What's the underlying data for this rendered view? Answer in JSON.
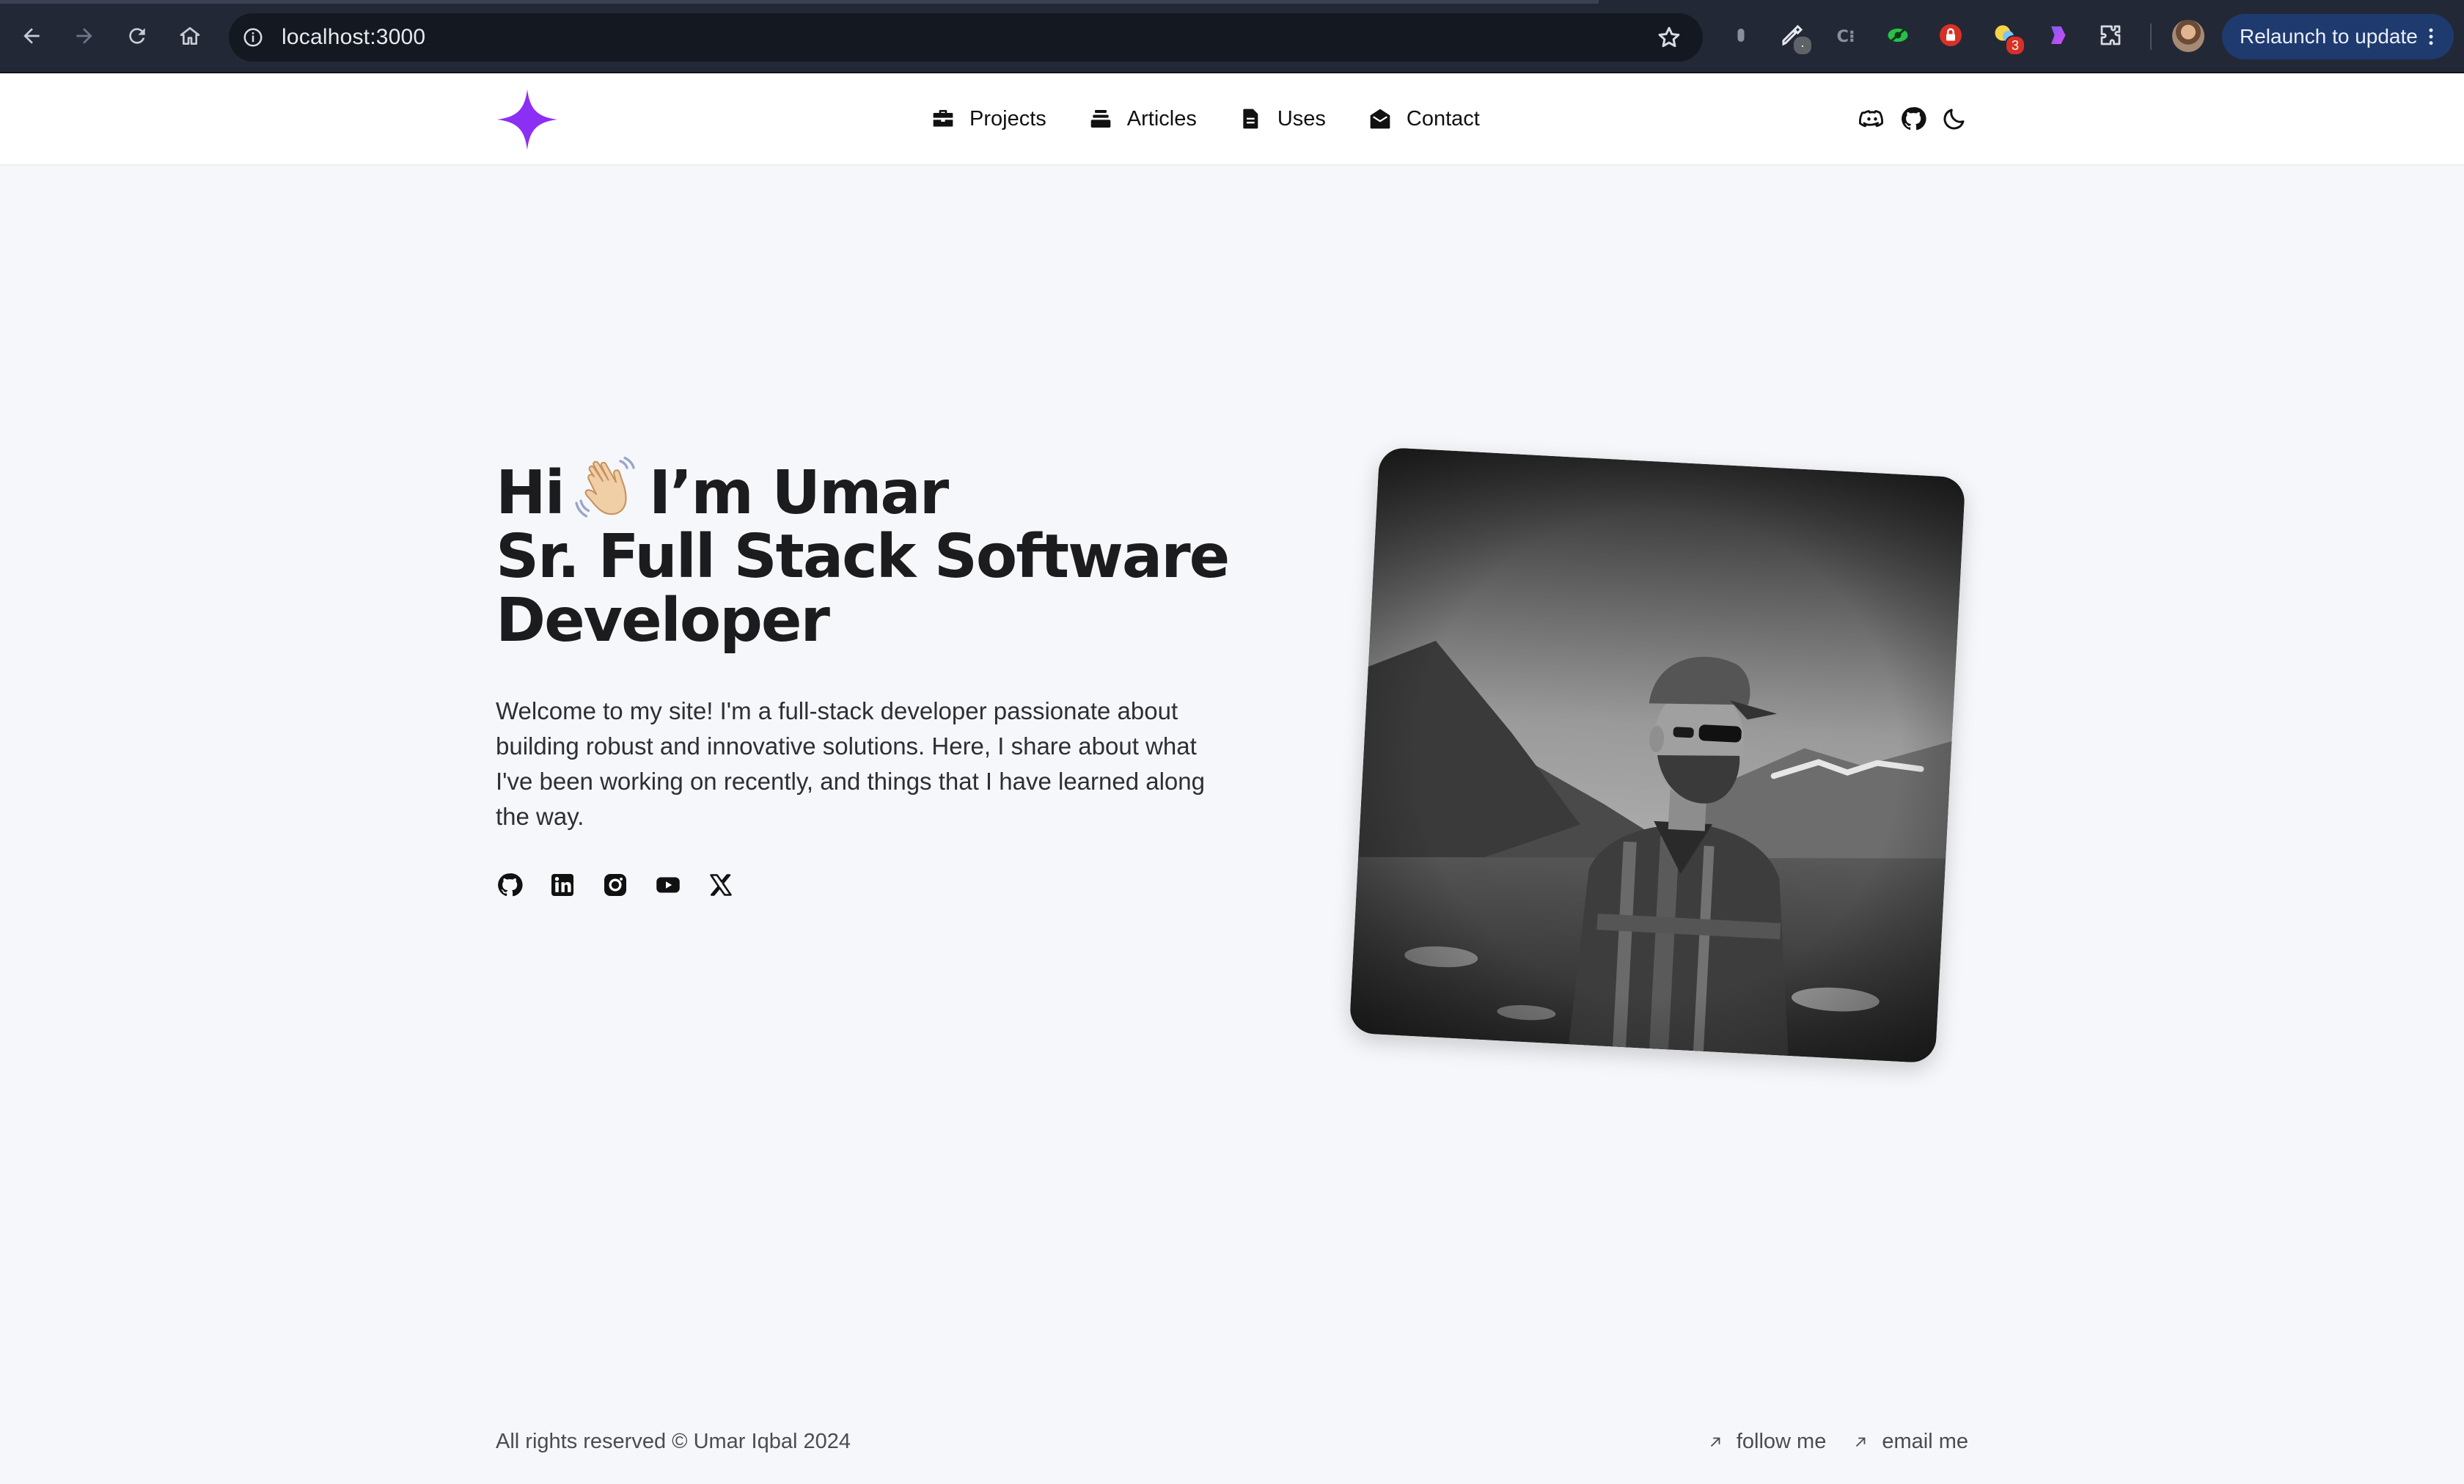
{
  "browser": {
    "url": "localhost:3000",
    "relaunch_label": "Relaunch to update",
    "extension_badges": {
      "ext_lock_badge": "3"
    },
    "icons": [
      "back-icon",
      "forward-icon",
      "reload-icon",
      "home-icon",
      "site-info-icon",
      "bookmark-star-icon",
      "extensions-puzzle-icon",
      "more-vert-icon"
    ]
  },
  "header": {
    "logo": "four-point-star-logo",
    "logo_color": "#8b2ff5",
    "nav": [
      {
        "label": "Projects",
        "icon": "briefcase-icon"
      },
      {
        "label": "Articles",
        "icon": "stack-icon"
      },
      {
        "label": "Uses",
        "icon": "document-icon"
      },
      {
        "label": "Contact",
        "icon": "envelope-icon"
      }
    ],
    "right_icons": [
      "discord-icon",
      "github-icon",
      "moon-icon"
    ]
  },
  "hero": {
    "greeting_hi": "Hi",
    "greeting_name": "I’m Umar",
    "title_line2": "Sr. Full Stack Software",
    "title_line3": "Developer",
    "description": "Welcome to my site! I'm a full-stack developer passionate about building robust and innovative solutions. Here, I share about what I've been working on recently, and things that I have learned along the way.",
    "socials": [
      "github-icon",
      "linkedin-icon",
      "instagram-icon",
      "youtube-icon",
      "x-icon"
    ]
  },
  "footer": {
    "copyright": "All rights reserved © Umar Iqbal 2024",
    "links": [
      {
        "label": "follow me",
        "icon": "arrow-up-right-icon"
      },
      {
        "label": "email me",
        "icon": "arrow-up-right-icon"
      }
    ]
  },
  "colors": {
    "page_bg": "#f5f7fa",
    "header_bg": "#ffffff",
    "chrome_bg": "#232836",
    "accent": "#8b2ff5",
    "text": "#1c1c1e"
  }
}
